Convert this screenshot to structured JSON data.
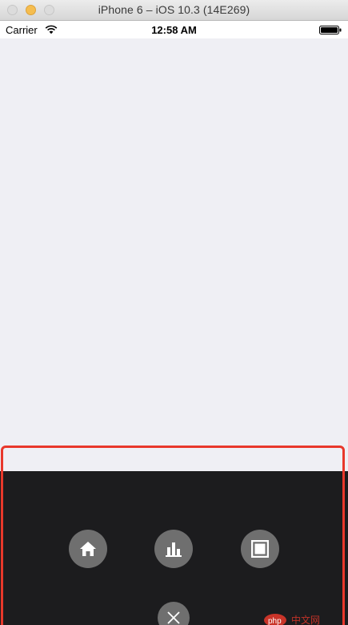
{
  "window": {
    "title": "iPhone 6 – iOS 10.3 (14E269)"
  },
  "status_bar": {
    "carrier": "Carrier",
    "time": "12:58 AM",
    "icons": [
      "wifi-icon",
      "battery-icon"
    ]
  },
  "action_sheet": {
    "buttons": [
      {
        "icon": "home-icon"
      },
      {
        "icon": "bar-chart-icon"
      },
      {
        "icon": "frame-icon"
      },
      {
        "icon": "close-icon"
      }
    ],
    "colors": {
      "background": "#1c1c1e",
      "button": "#6f6f6f",
      "highlight": "#e8382b"
    }
  },
  "watermark": {
    "text": "php中文网"
  }
}
